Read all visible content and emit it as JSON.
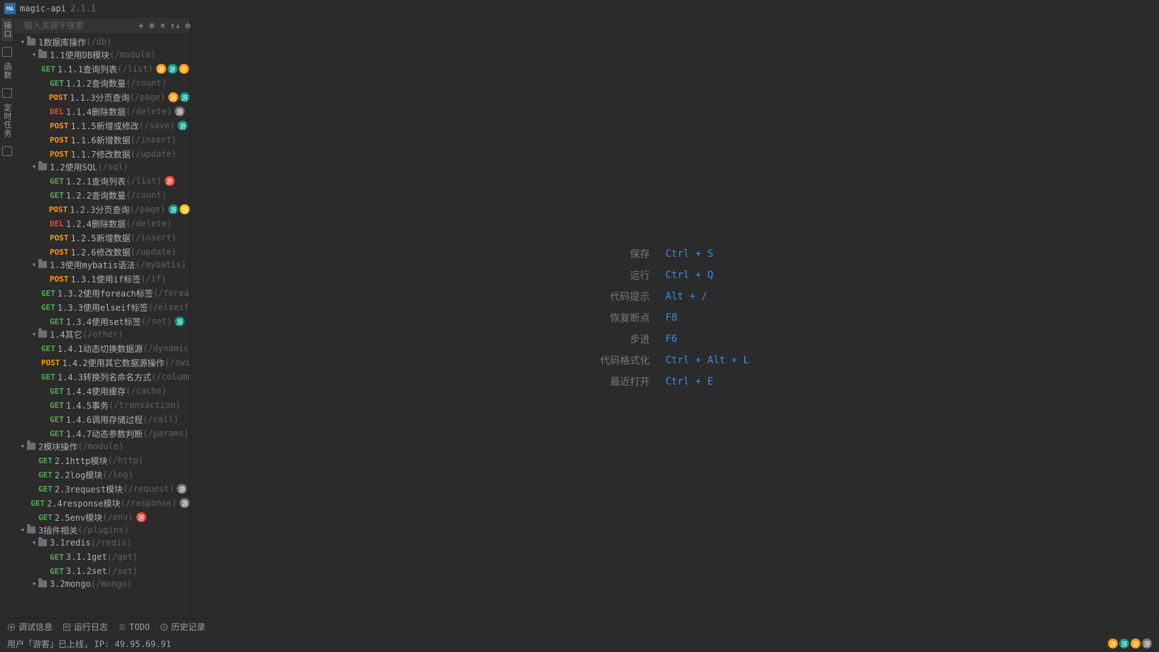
{
  "app": {
    "name": "magic-api",
    "version": "2.1.1"
  },
  "siderail": {
    "tabs": [
      {
        "label": "接口"
      },
      {
        "label": "函数"
      },
      {
        "label": "定时任务"
      }
    ]
  },
  "search": {
    "placeholder": "输入关键字搜索"
  },
  "toolbar_icons": [
    "add",
    "locate",
    "close",
    "sort",
    "settings",
    "more"
  ],
  "tree": [
    {
      "type": "folder",
      "name": "1数据库操作",
      "path": "(/db)",
      "depth": 0,
      "open": true
    },
    {
      "type": "folder",
      "name": "1.1使用DB模块",
      "path": "(/module)",
      "depth": 1,
      "open": true
    },
    {
      "type": "api",
      "method": "GET",
      "name": "1.1.1查询列表",
      "path": "(/list)",
      "depth": 2,
      "badges": [
        "orange",
        "teal",
        "orange",
        "gray"
      ]
    },
    {
      "type": "api",
      "method": "GET",
      "name": "1.1.2查询数量",
      "path": "(/count)",
      "depth": 2
    },
    {
      "type": "api",
      "method": "POST",
      "name": "1.1.3分页查询",
      "path": "(/page)",
      "depth": 2,
      "badges": [
        "orange",
        "teal"
      ]
    },
    {
      "type": "api",
      "method": "DEL",
      "name": "1.1.4删除数据",
      "path": "(/delete)",
      "depth": 2,
      "badges": [
        "gray"
      ]
    },
    {
      "type": "api",
      "method": "POST",
      "name": "1.1.5新增或修改",
      "path": "(/save)",
      "depth": 2,
      "badges": [
        "teal"
      ]
    },
    {
      "type": "api",
      "method": "POST",
      "name": "1.1.6新增数据",
      "path": "(/insert)",
      "depth": 2
    },
    {
      "type": "api",
      "method": "POST",
      "name": "1.1.7修改数据",
      "path": "(/update)",
      "depth": 2
    },
    {
      "type": "folder",
      "name": "1.2使用SQL",
      "path": "(/sql)",
      "depth": 1,
      "open": true
    },
    {
      "type": "api",
      "method": "GET",
      "name": "1.2.1查询列表",
      "path": "(/list)",
      "depth": 2,
      "badges": [
        "red"
      ]
    },
    {
      "type": "api",
      "method": "GET",
      "name": "1.2.2查询数量",
      "path": "(/count)",
      "depth": 2
    },
    {
      "type": "api",
      "method": "POST",
      "name": "1.2.3分页查询",
      "path": "(/page)",
      "depth": 2,
      "badges": [
        "teal",
        "yellow"
      ]
    },
    {
      "type": "api",
      "method": "DEL",
      "name": "1.2.4删除数据",
      "path": "(/delete)",
      "depth": 2
    },
    {
      "type": "api",
      "method": "POST",
      "name": "1.2.5新增数据",
      "path": "(/insert)",
      "depth": 2
    },
    {
      "type": "api",
      "method": "POST",
      "name": "1.2.6修改数据",
      "path": "(/update)",
      "depth": 2
    },
    {
      "type": "folder",
      "name": "1.3使用mybatis语法",
      "path": "(/mybatis)",
      "depth": 1,
      "open": true
    },
    {
      "type": "api",
      "method": "POST",
      "name": "1.3.1使用if标签",
      "path": "(/if)",
      "depth": 2
    },
    {
      "type": "api",
      "method": "GET",
      "name": "1.3.2使用foreach标签",
      "path": "(/foreach",
      "depth": 2
    },
    {
      "type": "api",
      "method": "GET",
      "name": "1.3.3使用elseif标签",
      "path": "(/elseif)",
      "depth": 2
    },
    {
      "type": "api",
      "method": "GET",
      "name": "1.3.4使用set标签",
      "path": "(/set)",
      "depth": 2,
      "badges": [
        "teal"
      ]
    },
    {
      "type": "folder",
      "name": "1.4其它",
      "path": "(/other)",
      "depth": 1,
      "open": true
    },
    {
      "type": "api",
      "method": "GET",
      "name": "1.4.1动态切换数据源",
      "path": "(/dynamic)",
      "depth": 2
    },
    {
      "type": "api",
      "method": "POST",
      "name": "1.4.2使用其它数据源操作",
      "path": "(/swit",
      "depth": 2
    },
    {
      "type": "api",
      "method": "GET",
      "name": "1.4.3转换列名命名方式",
      "path": "(/column)",
      "depth": 2
    },
    {
      "type": "api",
      "method": "GET",
      "name": "1.4.4使用缓存",
      "path": "(/cache)",
      "depth": 2
    },
    {
      "type": "api",
      "method": "GET",
      "name": "1.4.5事务",
      "path": "(/transaction)",
      "depth": 2
    },
    {
      "type": "api",
      "method": "GET",
      "name": "1.4.6调用存储过程",
      "path": "(/call)",
      "depth": 2
    },
    {
      "type": "api",
      "method": "GET",
      "name": "1.4.7动态参数判断",
      "path": "(/params)",
      "depth": 2
    },
    {
      "type": "folder",
      "name": "2模块操作",
      "path": "(/module)",
      "depth": 0,
      "open": true
    },
    {
      "type": "api",
      "method": "GET",
      "name": "2.1http模块",
      "path": "(/http)",
      "depth": 1
    },
    {
      "type": "api",
      "method": "GET",
      "name": "2.2log模块",
      "path": "(/log)",
      "depth": 1
    },
    {
      "type": "api",
      "method": "GET",
      "name": "2.3request模块",
      "path": "(/request)",
      "depth": 1,
      "badges": [
        "gray"
      ]
    },
    {
      "type": "api",
      "method": "GET",
      "name": "2.4response模块",
      "path": "(/response)",
      "depth": 1,
      "badges": [
        "gray"
      ]
    },
    {
      "type": "api",
      "method": "GET",
      "name": "2.5env模块",
      "path": "(/env)",
      "depth": 1,
      "badges": [
        "red"
      ]
    },
    {
      "type": "folder",
      "name": "3插件相关",
      "path": "(/plugins)",
      "depth": 0,
      "open": true
    },
    {
      "type": "folder",
      "name": "3.1redis",
      "path": "(/redis)",
      "depth": 1,
      "open": true
    },
    {
      "type": "api",
      "method": "GET",
      "name": "3.1.1get",
      "path": "(/get)",
      "depth": 2
    },
    {
      "type": "api",
      "method": "GET",
      "name": "3.1.2set",
      "path": "(/set)",
      "depth": 2
    },
    {
      "type": "folder",
      "name": "3.2mongo",
      "path": "(/mongo)",
      "depth": 1,
      "open": true
    }
  ],
  "shortcuts": [
    {
      "label": "保存",
      "key": "Ctrl + S"
    },
    {
      "label": "运行",
      "key": "Ctrl + Q"
    },
    {
      "label": "代码提示",
      "key": "Alt + /"
    },
    {
      "label": "恢复断点",
      "key": "F8"
    },
    {
      "label": "步进",
      "key": "F6"
    },
    {
      "label": "代码格式化",
      "key": "Ctrl + Alt + L"
    },
    {
      "label": "最近打开",
      "key": "Ctrl + E"
    }
  ],
  "bottom_tabs": [
    {
      "label": "调试信息"
    },
    {
      "label": "运行日志"
    },
    {
      "label": "TODO"
    },
    {
      "label": "历史记录"
    }
  ],
  "status": {
    "text": "用户「游客」已上线, IP: 49.95.69.91",
    "avatars": [
      "orange",
      "teal",
      "orange",
      "gray"
    ],
    "badge_char": "游"
  }
}
